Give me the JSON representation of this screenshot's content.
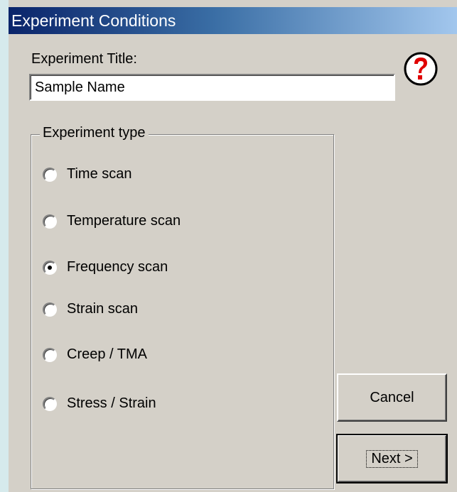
{
  "window": {
    "title": "Experiment Conditions"
  },
  "title_field": {
    "label": "Experiment Title:",
    "value": "Sample Name"
  },
  "help": {
    "icon": "help-question-icon",
    "color": "#e00000"
  },
  "experiment_type": {
    "legend": "Experiment type",
    "options": [
      {
        "label": "Time scan",
        "selected": false
      },
      {
        "label": "Temperature scan",
        "selected": false
      },
      {
        "label": "Frequency scan",
        "selected": true
      },
      {
        "label": "Strain scan",
        "selected": false
      },
      {
        "label": "Creep / TMA",
        "selected": false
      },
      {
        "label": "Stress / Strain",
        "selected": false
      }
    ]
  },
  "buttons": {
    "cancel": "Cancel",
    "next": "Next >"
  },
  "colors": {
    "titlebar_start": "#0a246a",
    "titlebar_end": "#a6caf0",
    "dialog_bg": "#d4d0c8"
  }
}
